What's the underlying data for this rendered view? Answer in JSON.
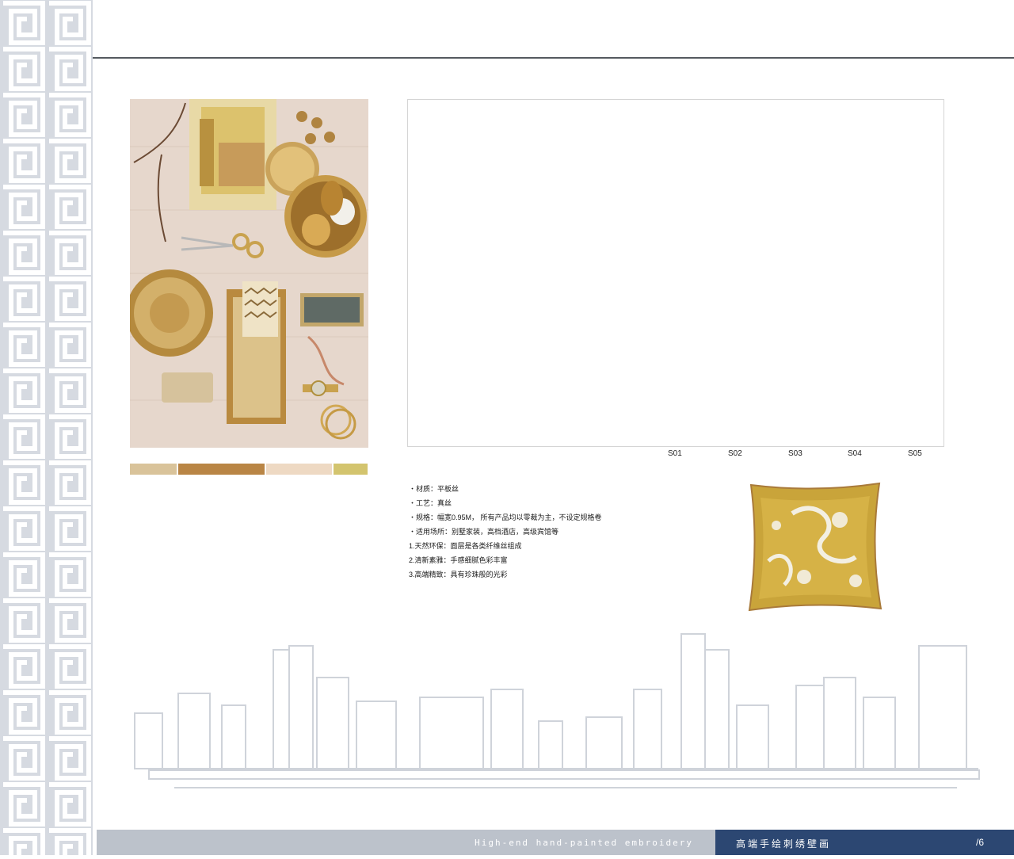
{
  "colors": {
    "band": "#d6dae1",
    "rule": "#555a60",
    "footer_gray": "#bcc2cb",
    "footer_blue": "#2c4772"
  },
  "moodboard": {
    "description_icon": "gold-moodboard-photo"
  },
  "swatches": [
    {
      "color": "#d9c39a"
    },
    {
      "color": "#b98545"
    },
    {
      "color": "#eed9c3"
    },
    {
      "color": "#d3c46e"
    }
  ],
  "chart_codes": [
    "S01",
    "S02",
    "S03",
    "S04",
    "S05"
  ],
  "specs": [
    "・材质：平板丝",
    "・工艺：真丝",
    "・规格：幅宽0.95M， 所有产品均以零裁为主，不设定规格卷",
    "・适用场所：别墅家装，高档酒店，高级宾馆等",
    "1.天然环保：面层是各类纤维丝组成",
    "2.清新素雅：手感细腻色彩丰富",
    "3.高端精致：具有珍珠般的光彩"
  ],
  "pillow": {
    "icon": "dragon-silk-pillow"
  },
  "footer": {
    "english": "High-end hand-painted embroidery",
    "chinese": "高端手绘刺绣壁画",
    "page": "/6"
  }
}
